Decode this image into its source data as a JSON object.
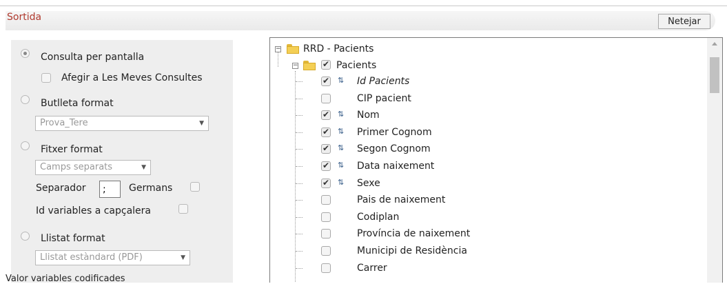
{
  "header": {
    "title": "Sortida",
    "clear_button": "Netejar"
  },
  "left": {
    "consulta_pantalla": "Consulta per pantalla",
    "afegir_consultes": "Afegir a Les Meves Consultes",
    "butlleta_format": "Butlleta format",
    "butlleta_select": "Prova_Tere",
    "fitxer_format": "Fitxer format",
    "fitxer_select": "Camps separats",
    "separador": "Separador",
    "separador_value": ";",
    "germans": "Germans",
    "id_variables": "Id variables a capçalera",
    "llistat_format": "Llistat format",
    "llistat_select": "Llistat estàndard (PDF)",
    "valor_variables": "Valor variables codificades"
  },
  "tree": {
    "root": "RRD - Pacients",
    "group": "Pacients",
    "items": [
      {
        "label": "Id Pacients",
        "checked": true,
        "sort": true,
        "italic": true
      },
      {
        "label": "CIP pacient",
        "checked": false,
        "sort": false
      },
      {
        "label": "Nom",
        "checked": true,
        "sort": true
      },
      {
        "label": "Primer Cognom",
        "checked": true,
        "sort": true
      },
      {
        "label": "Segon Cognom",
        "checked": true,
        "sort": true
      },
      {
        "label": "Data naixement",
        "checked": true,
        "sort": true
      },
      {
        "label": "Sexe",
        "checked": true,
        "sort": true
      },
      {
        "label": "Pais de naixement",
        "checked": false,
        "sort": false
      },
      {
        "label": "Codiplan",
        "checked": false,
        "sort": false
      },
      {
        "label": "Província de naixement",
        "checked": false,
        "sort": false
      },
      {
        "label": "Municipi de Residència",
        "checked": false,
        "sort": false
      },
      {
        "label": "Carrer",
        "checked": false,
        "sort": false
      }
    ]
  },
  "icons": {
    "sort": "sort-arrows-icon",
    "folder": "folder-icon",
    "expand": "collapse-minus-icon",
    "dropdown": "chevron-down-icon"
  }
}
